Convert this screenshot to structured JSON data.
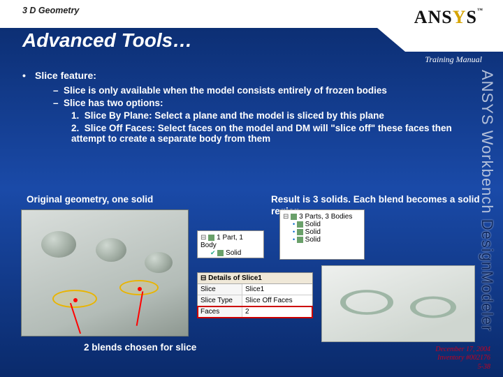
{
  "header": {
    "subtitle": "3 D Geometry",
    "title": "Advanced Tools…",
    "logo": {
      "a": "ANS",
      "y": "Y",
      "s": "S",
      "tm": "™"
    },
    "training": "Training Manual",
    "sidetext_wb": "ANSYS Workbench ",
    "sidetext_dm": "DesignModeler"
  },
  "content": {
    "b1": "Slice feature:",
    "b2a": "Slice is only available when the model consists entirely of frozen bodies",
    "b2b": "Slice has two options:",
    "b3a": "Slice By Plane: Select a plane and the model is sliced by this plane",
    "b3b": "Slice Off Faces: Select faces on the model and DM will \"slice off\" these faces then attempt to create a separate body from them"
  },
  "captions": {
    "left": "Original geometry, one solid",
    "right": "Result is 3 solids. Each blend becomes a solid region",
    "blends": "2 blends chosen for slice"
  },
  "tree1": {
    "root": "1 Part, 1 Body",
    "child": "Solid"
  },
  "tree2": {
    "root": "3 Parts, 3 Bodies",
    "c1": "Solid",
    "c2": "Solid",
    "c3": "Solid"
  },
  "details": {
    "title": "Details of Slice1",
    "rows": [
      {
        "label": "Slice",
        "value": "Slice1"
      },
      {
        "label": "Slice Type",
        "value": "Slice Off Faces"
      },
      {
        "label": "Faces",
        "value": "2"
      }
    ]
  },
  "footer": {
    "date": "December 17, 2004",
    "inv": "Inventory #002176",
    "page": "5-38"
  }
}
